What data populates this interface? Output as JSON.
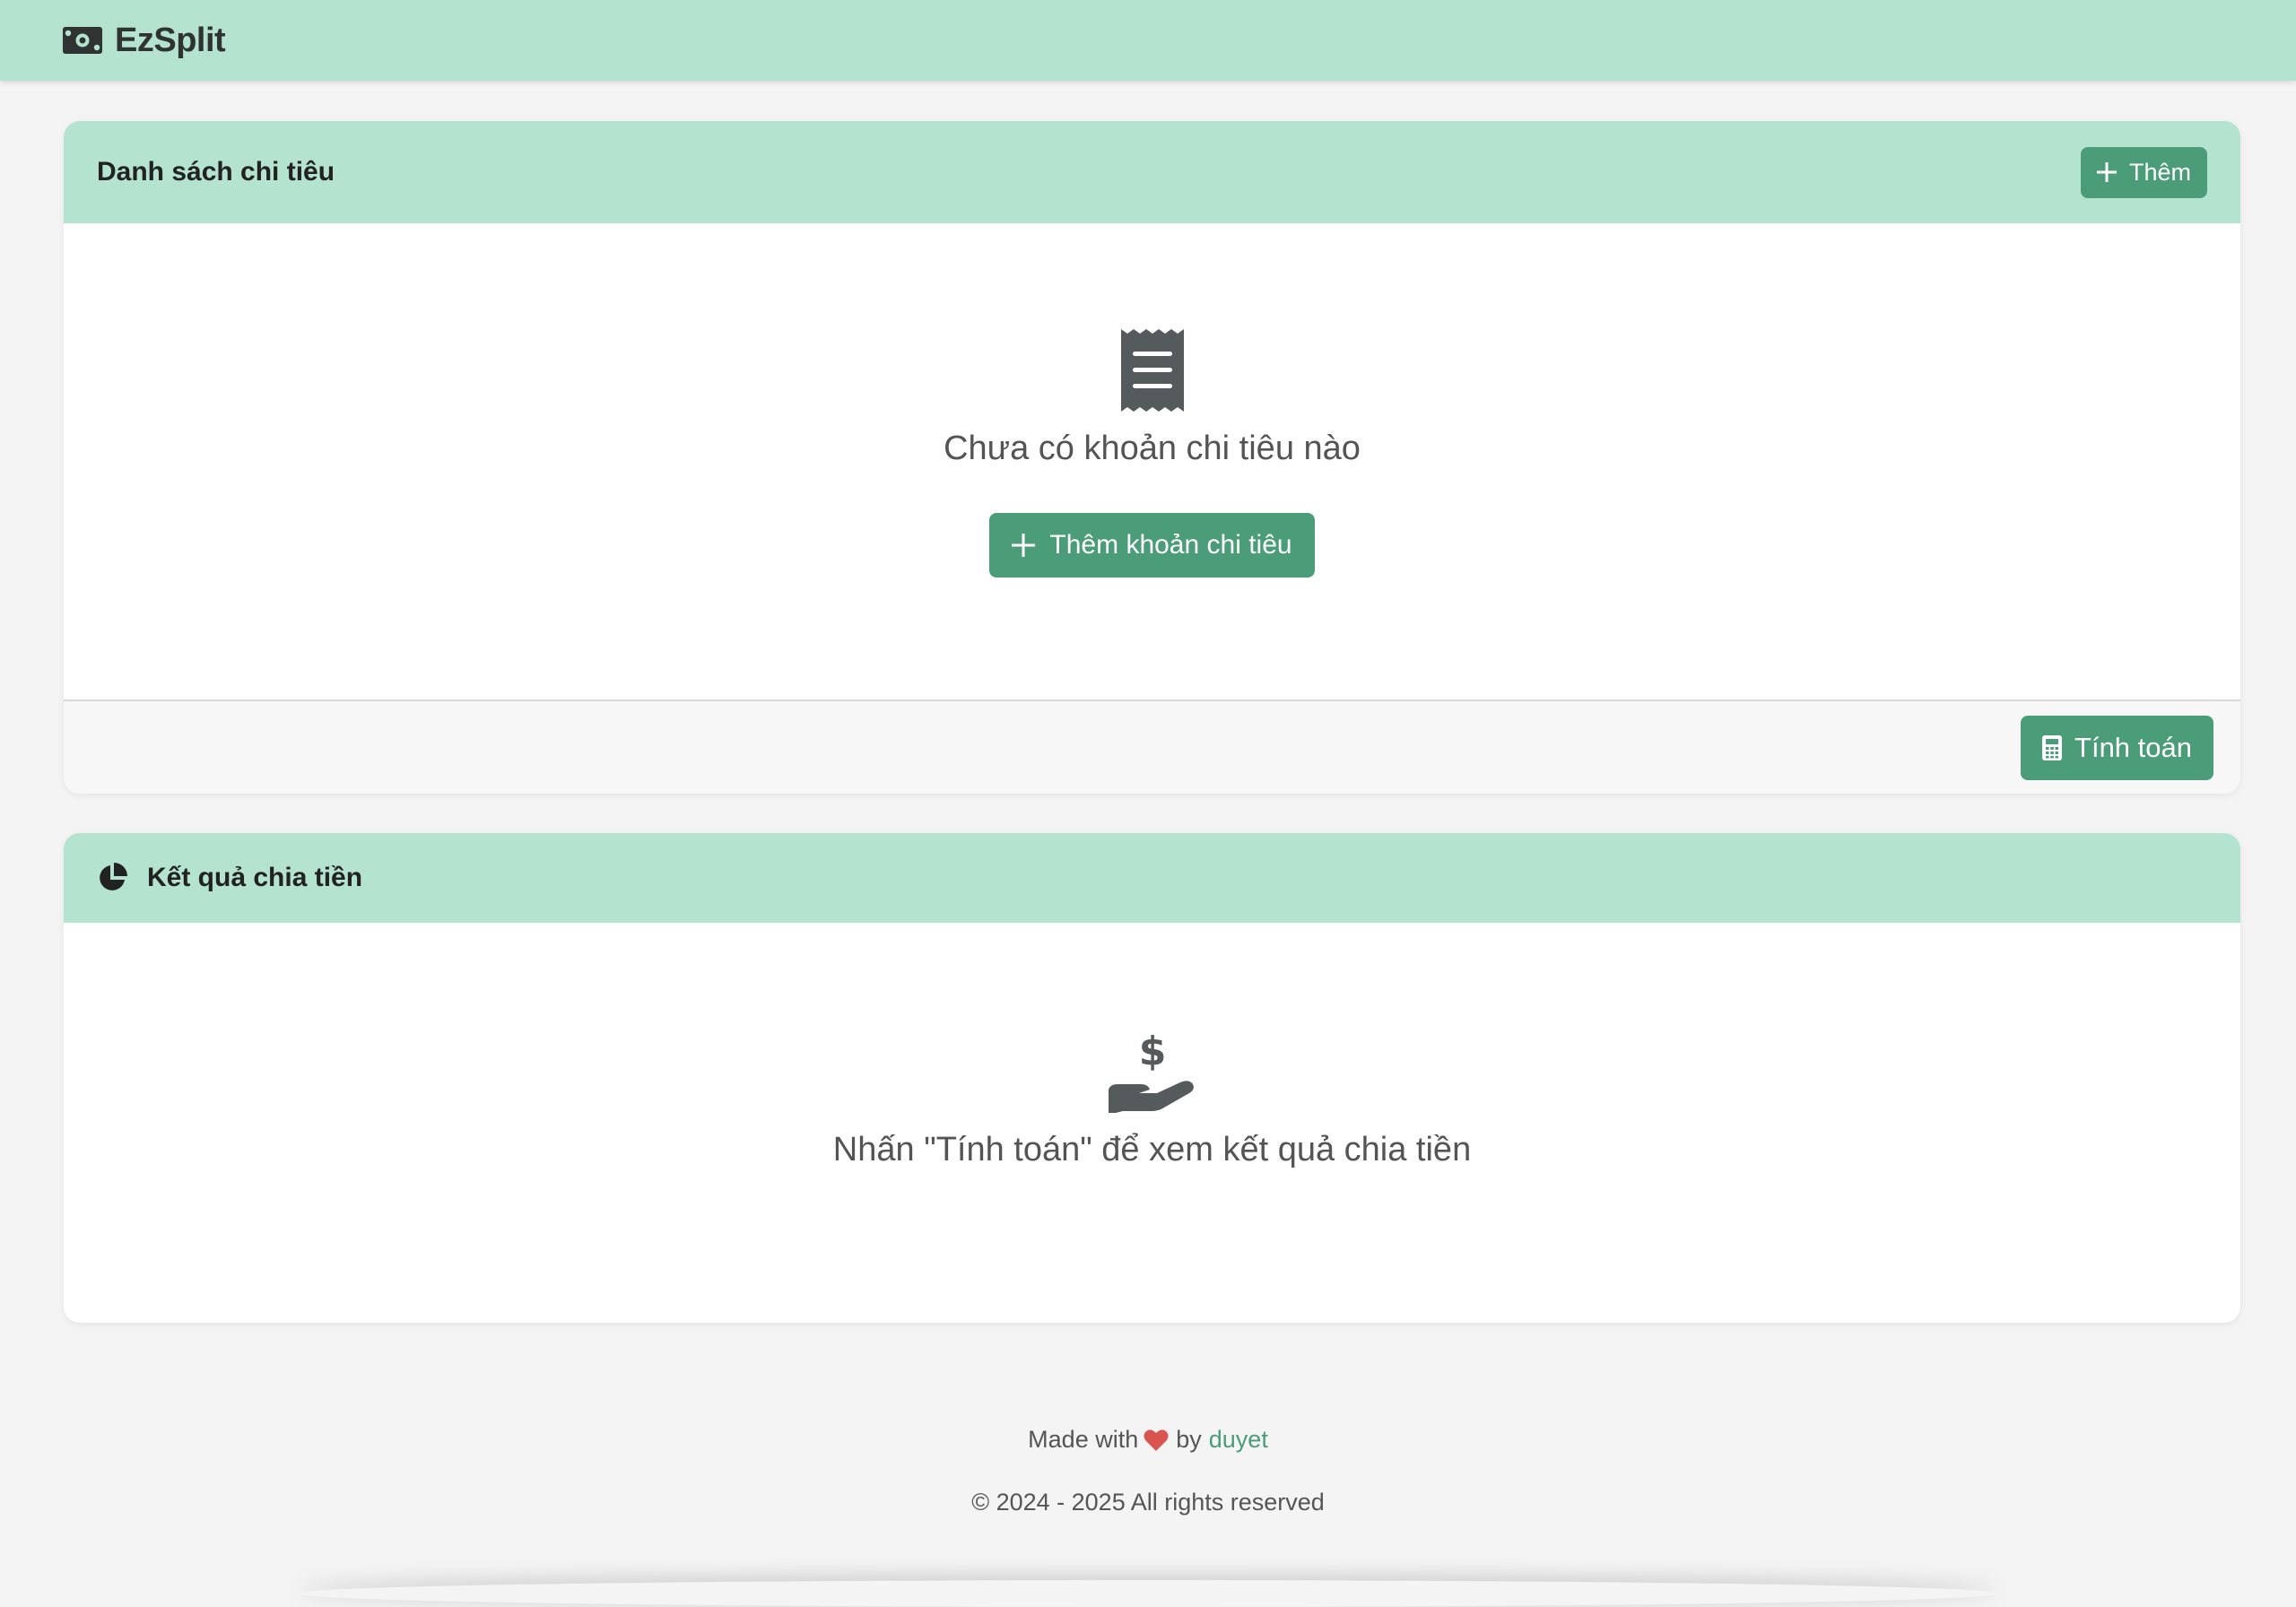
{
  "navbar": {
    "brand": "EzSplit",
    "brand_icon": "money-bill-icon"
  },
  "expenses_card": {
    "title": "Danh sách chi tiêu",
    "add_button_label": "Thêm",
    "empty_icon": "receipt-icon",
    "empty_text": "Chưa có khoản chi tiêu nào",
    "add_expense_button_label": "Thêm khoản chi tiêu",
    "calculate_button_label": "Tính toán"
  },
  "results_card": {
    "title": "Kết quả chia tiền",
    "title_icon": "pie-chart-icon",
    "empty_icon": "hand-holding-dollar-icon",
    "empty_text": "Nhấn \"Tính toán\" để xem kết quả chia tiền"
  },
  "footer": {
    "made_with": "Made with",
    "by": "by",
    "author": "duyet",
    "copyright": "© 2024 - 2025 All rights reserved"
  },
  "colors": {
    "header_bg": "#b4e3cf",
    "primary_button": "#4a9d78",
    "page_bg": "#f4f4f4",
    "heart": "#d9534f"
  }
}
